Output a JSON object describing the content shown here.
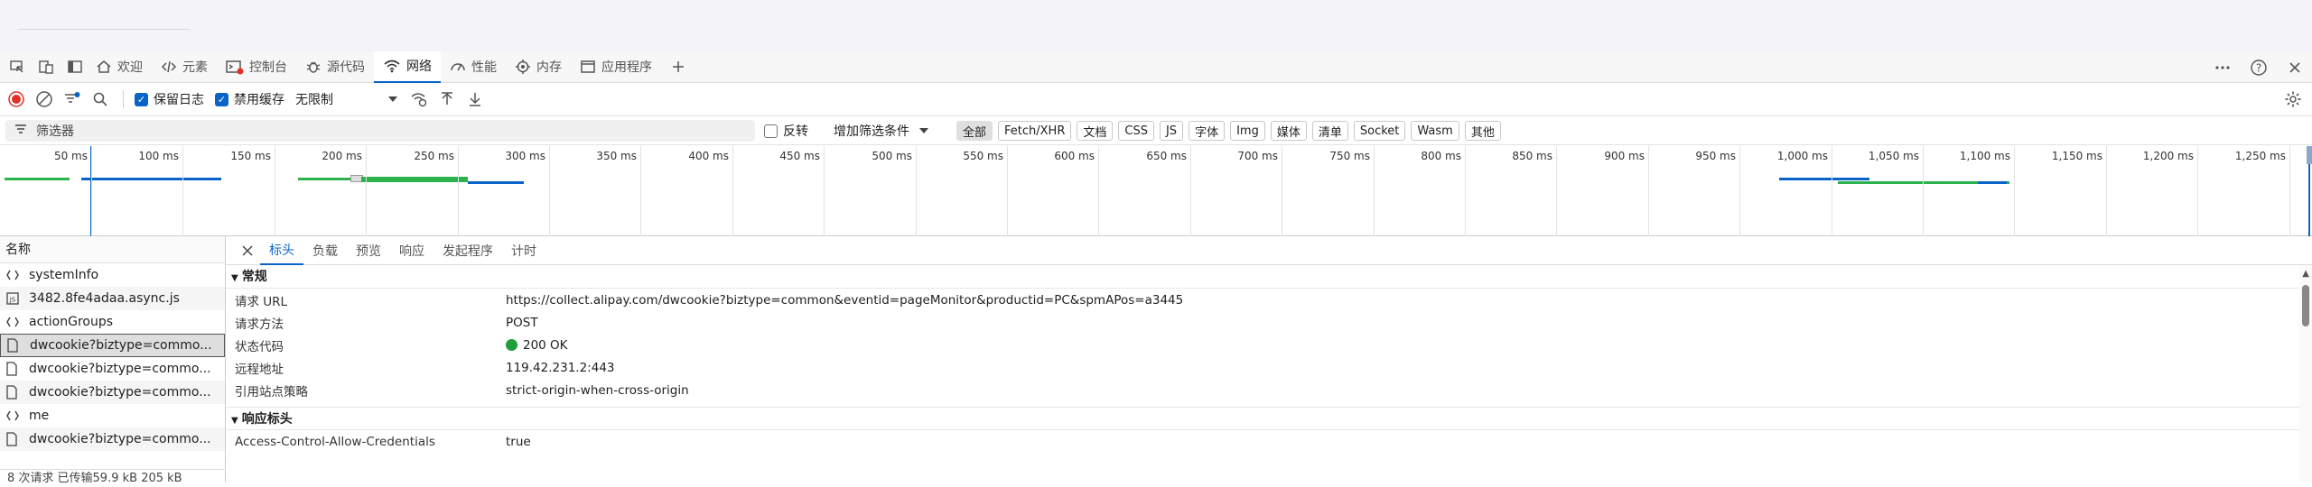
{
  "tabbar": {
    "tabs": [
      {
        "label": "欢迎",
        "icon": "home-icon"
      },
      {
        "label": "元素",
        "icon": "code-icon"
      },
      {
        "label": "控制台",
        "icon": "console-icon"
      },
      {
        "label": "源代码",
        "icon": "bug-icon"
      },
      {
        "label": "网络",
        "icon": "wifi-icon"
      },
      {
        "label": "性能",
        "icon": "gauge-icon"
      },
      {
        "label": "内存",
        "icon": "cpu-icon"
      },
      {
        "label": "应用程序",
        "icon": "app-icon"
      }
    ]
  },
  "toolbar": {
    "preserve_log": "保留日志",
    "disable_cache": "禁用缓存",
    "throttle": "无限制"
  },
  "filterbar": {
    "placeholder": "筛选器",
    "invert": "反转",
    "more_filters": "增加筛选条件",
    "chips": [
      "全部",
      "Fetch/XHR",
      "文档",
      "CSS",
      "JS",
      "字体",
      "Img",
      "媒体",
      "清单",
      "Socket",
      "Wasm",
      "其他"
    ]
  },
  "timeline": {
    "ticks": [
      "50 ms",
      "100 ms",
      "150 ms",
      "200 ms",
      "250 ms",
      "300 ms",
      "350 ms",
      "400 ms",
      "450 ms",
      "500 ms",
      "550 ms",
      "600 ms",
      "650 ms",
      "700 ms",
      "750 ms",
      "800 ms",
      "850 ms",
      "900 ms",
      "950 ms",
      "1,000 ms",
      "1,050 ms",
      "1,100 ms",
      "1,150 ms",
      "1,200 ms",
      "1,250 ms"
    ]
  },
  "requests": {
    "header": "名称",
    "rows": [
      {
        "name": "systemInfo",
        "icon": "xhr-icon"
      },
      {
        "name": "3482.8fe4adaa.async.js",
        "icon": "js-icon"
      },
      {
        "name": "actionGroups",
        "icon": "xhr-icon"
      },
      {
        "name": "dwcookie?biztype=commo...",
        "icon": "doc-icon"
      },
      {
        "name": "dwcookie?biztype=commo...",
        "icon": "doc-icon"
      },
      {
        "name": "dwcookie?biztype=commo...",
        "icon": "doc-icon"
      },
      {
        "name": "me",
        "icon": "xhr-icon"
      },
      {
        "name": "dwcookie?biztype=commo...",
        "icon": "doc-icon"
      }
    ],
    "status": "8 次请求 已传输59.9 kB 205 kB"
  },
  "detail": {
    "tabs": [
      "标头",
      "负载",
      "预览",
      "响应",
      "发起程序",
      "计时"
    ],
    "general_title": "常规",
    "general": [
      {
        "key": "请求 URL",
        "value": "https://collect.alipay.com/dwcookie?biztype=common&eventid=pageMonitor&productid=PC&spmAPos=a3445"
      },
      {
        "key": "请求方法",
        "value": "POST"
      },
      {
        "key": "状态代码",
        "value": "200 OK"
      },
      {
        "key": "远程地址",
        "value": "119.42.231.2:443"
      },
      {
        "key": "引用站点策略",
        "value": "strict-origin-when-cross-origin"
      }
    ],
    "response_title": "响应标头",
    "response": [
      {
        "key": "Access-Control-Allow-Credentials",
        "value": "true"
      }
    ]
  },
  "colors": {
    "accent": "#0a64c8",
    "record": "#e0302a",
    "ok": "#1e9e3c"
  }
}
